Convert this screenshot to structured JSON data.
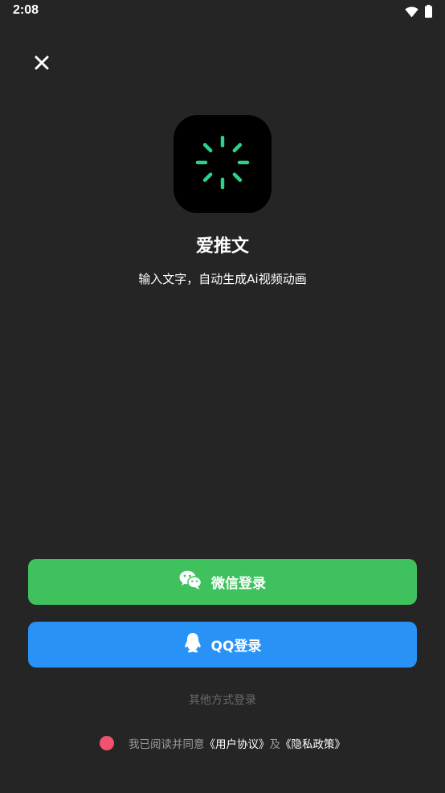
{
  "status_bar": {
    "time": "2:08",
    "icons": [
      "wifi-icon",
      "battery-icon"
    ]
  },
  "header": {
    "close_icon": "close-icon"
  },
  "app": {
    "name": "爱推文",
    "slogan": "输入文字，自动生成Ai视频动画",
    "icon": "loading-spinner-logo",
    "icon_color": "#2fd08a"
  },
  "login": {
    "wechat_label": "微信登录",
    "wechat_icon": "wechat-icon",
    "wechat_color": "#3fc25e",
    "qq_label": "QQ登录",
    "qq_icon": "qq-icon",
    "qq_color": "#2892f6",
    "other_label": "其他方式登录"
  },
  "agreement": {
    "prefix": "我已阅读并同意",
    "user_agreement": "《用户协议》",
    "and": "及",
    "privacy_policy": "《隐私政策》",
    "checkbox_color": "#f0526f"
  }
}
